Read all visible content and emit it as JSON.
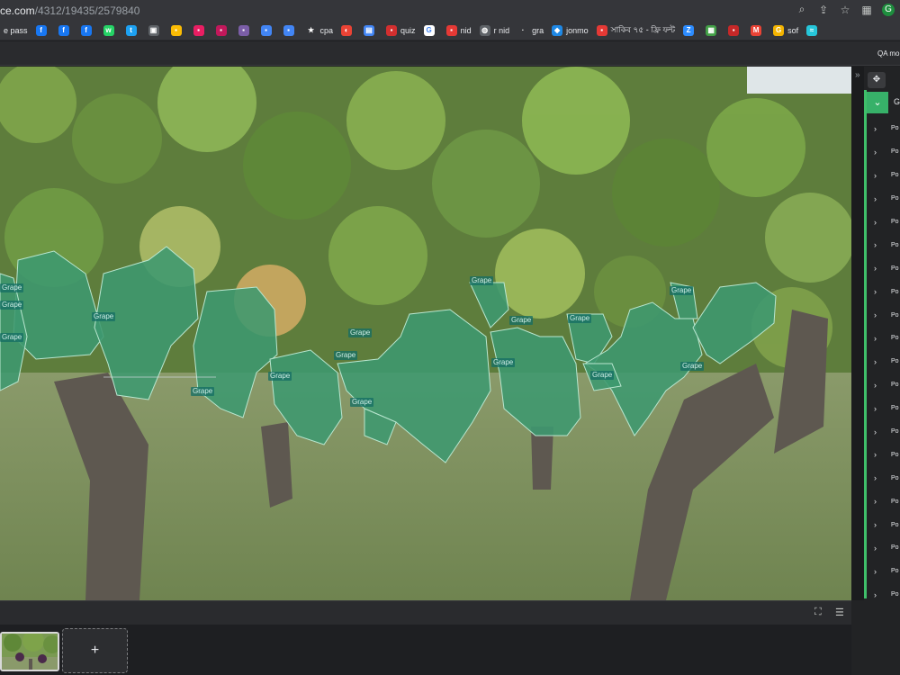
{
  "browser": {
    "url_host": "ce.com",
    "url_path": "/4312/19435/2579840",
    "right_icons": [
      "zoom-icon",
      "share-icon",
      "star-icon",
      "extensions-icon",
      "profile-icon"
    ]
  },
  "bookmarks": [
    {
      "label": "e pass",
      "icon": "",
      "color": "#35363a"
    },
    {
      "label": "",
      "icon": "f",
      "color": "#1877f2"
    },
    {
      "label": "",
      "icon": "f",
      "color": "#1877f2"
    },
    {
      "label": "",
      "icon": "f",
      "color": "#1877f2"
    },
    {
      "label": "",
      "icon": "w",
      "color": "#25d366"
    },
    {
      "label": "",
      "icon": "t",
      "color": "#1da1f2"
    },
    {
      "label": "",
      "icon": "▣",
      "color": "#5f6368"
    },
    {
      "label": "",
      "icon": "▪",
      "color": "#fbbc04"
    },
    {
      "label": "",
      "icon": "▪",
      "color": "#e91e63"
    },
    {
      "label": "",
      "icon": "▪",
      "color": "#c2185b"
    },
    {
      "label": "",
      "icon": "▪",
      "color": "#7b5ea7"
    },
    {
      "label": "",
      "icon": "▪",
      "color": "#4285f4"
    },
    {
      "label": "",
      "icon": "▪",
      "color": "#4285f4"
    },
    {
      "label": "cpa",
      "icon": "★",
      "color": "#35363a"
    },
    {
      "label": "",
      "icon": "◐",
      "color": "#ea4335"
    },
    {
      "label": "",
      "icon": "▤",
      "color": "#4285f4"
    },
    {
      "label": "quiz",
      "icon": "▪",
      "color": "#d32f2f"
    },
    {
      "label": "",
      "icon": "G",
      "color": "#ffffff"
    },
    {
      "label": "nid",
      "icon": "▪",
      "color": "#e53935"
    },
    {
      "label": "r nid",
      "icon": "◍",
      "color": "#5f6368"
    },
    {
      "label": "gra",
      "icon": "·",
      "color": "#35363a"
    },
    {
      "label": "jonmo",
      "icon": "◆",
      "color": "#1e88e5"
    },
    {
      "label": "সাকিব ৭৫ - ফ্রি ফন্ট",
      "icon": "▪",
      "color": "#e53935"
    },
    {
      "label": "",
      "icon": "Z",
      "color": "#2d8cff"
    },
    {
      "label": "",
      "icon": "▦",
      "color": "#43a047"
    },
    {
      "label": "",
      "icon": "▪",
      "color": "#c62828"
    },
    {
      "label": "",
      "icon": "M",
      "color": "#ea4335"
    },
    {
      "label": "sof",
      "icon": "G",
      "color": "#f4b400"
    },
    {
      "label": "",
      "icon": "≈",
      "color": "#26c6da"
    }
  ],
  "topbar": {
    "qa_text": "QA mo"
  },
  "canvas": {
    "annotation_color": "#3d9970",
    "labels": [
      {
        "text": "Grape"
      },
      {
        "text": "Grape"
      },
      {
        "text": "Grape"
      },
      {
        "text": "Grape"
      },
      {
        "text": "Grape"
      },
      {
        "text": "Grape"
      },
      {
        "text": "Grape"
      },
      {
        "text": "Grape"
      },
      {
        "text": "Grape"
      },
      {
        "text": "Grape"
      },
      {
        "text": "Grape"
      },
      {
        "text": "Grape"
      },
      {
        "text": "Grape"
      },
      {
        "text": "Grape"
      },
      {
        "text": "Grape"
      },
      {
        "text": "Grape"
      }
    ]
  },
  "panel": {
    "accent": "#37b169",
    "first_item": "G",
    "items": [
      "Po",
      "Po",
      "Po",
      "Po",
      "Po",
      "Po",
      "Po",
      "Po",
      "Po",
      "Po",
      "Po",
      "Po",
      "Po",
      "Po",
      "Po",
      "Po",
      "Po",
      "Po",
      "Po",
      "Po",
      "Po"
    ]
  },
  "bottom": {
    "add_label": "+"
  }
}
